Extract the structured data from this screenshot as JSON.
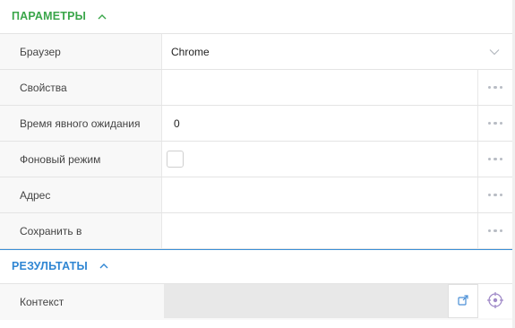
{
  "params": {
    "title": "ПАРАМЕТРЫ",
    "rows": [
      {
        "label": "Браузер",
        "value": "Chrome"
      },
      {
        "label": "Свойства",
        "value": ""
      },
      {
        "label": "Время явного ожидания",
        "value": "0"
      },
      {
        "label": "Фоновый режим",
        "value": ""
      },
      {
        "label": "Адрес",
        "value": ""
      },
      {
        "label": "Сохранить в",
        "value": ""
      }
    ]
  },
  "results": {
    "title": "РЕЗУЛЬТАТЫ",
    "rows": [
      {
        "label": "Контекст",
        "value": ""
      }
    ]
  },
  "colors": {
    "params_accent": "#3aa64a",
    "results_accent": "#2f86d3"
  },
  "icons": {
    "collapse": "chevron-up-icon",
    "select": "chevron-down-icon",
    "more": "more-dots-icon",
    "open": "open-external-icon",
    "target": "target-icon"
  }
}
